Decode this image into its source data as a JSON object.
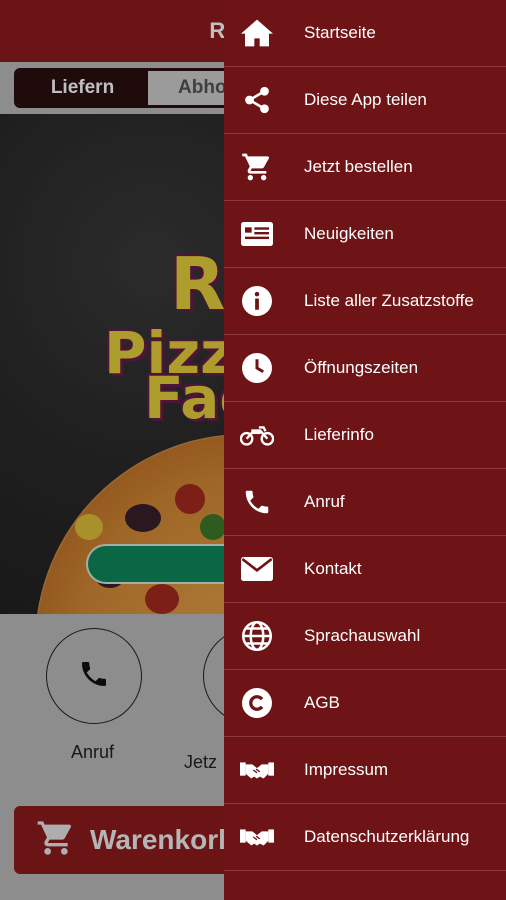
{
  "app": {
    "title": "Rialto I",
    "toggle": {
      "deliver": "Liefern",
      "pickup": "Abho"
    },
    "hero": {
      "logo_line1": "Ri",
      "logo_line2": "Pizz",
      "logo_line3": "Fac"
    },
    "quick_actions": [
      {
        "label": "Anruf",
        "icon": "phone-icon"
      },
      {
        "label": "Jetz",
        "icon": "cart-icon"
      }
    ],
    "cart_label": "Warenkorl",
    "colors": {
      "header": "#8e1b1d",
      "drawer": "#6f1416",
      "order_button": "#0f8a5a"
    }
  },
  "drawer": {
    "items": [
      {
        "label": "Startseite",
        "icon": "home-icon"
      },
      {
        "label": "Diese App teilen",
        "icon": "share-icon"
      },
      {
        "label": "Jetzt bestellen",
        "icon": "cart-icon"
      },
      {
        "label": "Neuigkeiten",
        "icon": "news-icon"
      },
      {
        "label": "Liste aller Zusatzstoffe",
        "icon": "info-icon"
      },
      {
        "label": "Öffnungszeiten",
        "icon": "clock-icon"
      },
      {
        "label": "Lieferinfo",
        "icon": "motorcycle-icon"
      },
      {
        "label": "Anruf",
        "icon": "phone-icon"
      },
      {
        "label": "Kontakt",
        "icon": "mail-icon"
      },
      {
        "label": "Sprachauswahl",
        "icon": "globe-icon"
      },
      {
        "label": "AGB",
        "icon": "copyright-icon"
      },
      {
        "label": "Impressum",
        "icon": "handshake-icon"
      },
      {
        "label": "Datenschutzerklärung",
        "icon": "handshake-icon"
      }
    ]
  }
}
